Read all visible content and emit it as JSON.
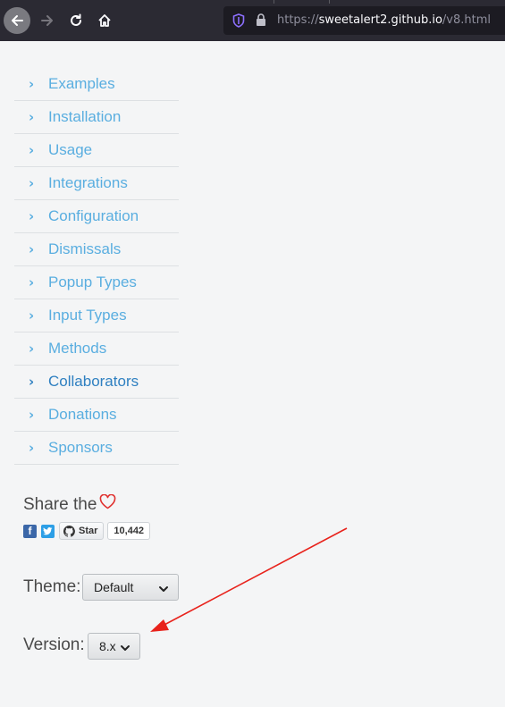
{
  "browser": {
    "url_prefix": "https://",
    "url_host": "sweetalert2.github.io",
    "url_path": "/v8.html"
  },
  "nav": {
    "items": [
      {
        "label": "Examples",
        "active": false
      },
      {
        "label": "Installation",
        "active": false
      },
      {
        "label": "Usage",
        "active": false
      },
      {
        "label": "Integrations",
        "active": false
      },
      {
        "label": "Configuration",
        "active": false
      },
      {
        "label": "Dismissals",
        "active": false
      },
      {
        "label": "Popup Types",
        "active": false
      },
      {
        "label": "Input Types",
        "active": false
      },
      {
        "label": "Methods",
        "active": false
      },
      {
        "label": "Collaborators",
        "active": true
      },
      {
        "label": "Donations",
        "active": false
      },
      {
        "label": "Sponsors",
        "active": false
      }
    ],
    "chevron": "›"
  },
  "share": {
    "title": "Share the",
    "heart_icon": "heart-outline-icon",
    "heart_color": "#e0312f",
    "github_star_label": "Star",
    "github_star_count": "10,442"
  },
  "theme": {
    "label": "Theme:",
    "selected": "Default"
  },
  "version": {
    "label": "Version:",
    "selected": "8.x"
  },
  "annotation": {
    "arrow_color": "#e8221b"
  }
}
